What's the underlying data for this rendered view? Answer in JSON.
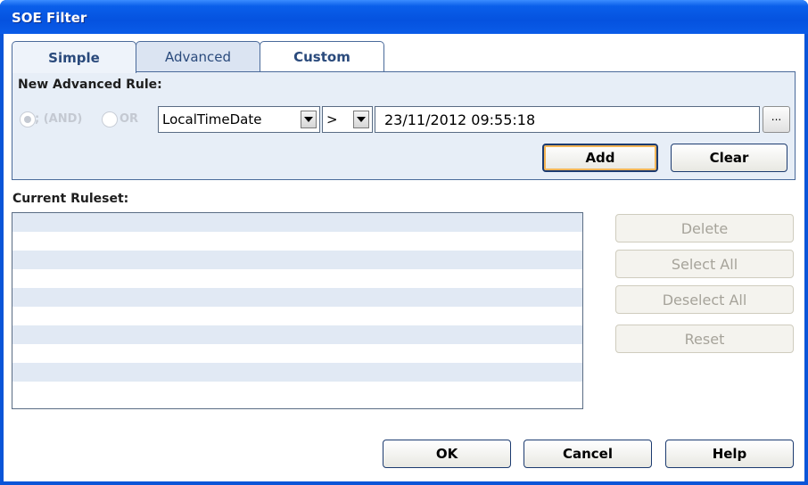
{
  "window": {
    "title": "SOE Filter"
  },
  "tabs": [
    {
      "label": "Simple",
      "state": "active"
    },
    {
      "label": "Advanced",
      "state": "inactive"
    },
    {
      "label": "Custom",
      "state": "plain"
    }
  ],
  "new_rule": {
    "heading": "New Advanced Rule:",
    "radio_and": {
      "label": "; (AND)",
      "checked": true,
      "enabled": false
    },
    "radio_or": {
      "label": "OR",
      "checked": false,
      "enabled": false
    },
    "field_combo": {
      "value": "LocalTimeDate"
    },
    "operator_combo": {
      "value": ">"
    },
    "value_input": {
      "value": "23/11/2012 09:55:18"
    },
    "browse_button": {
      "label": "..."
    },
    "add_button": {
      "label": "Add"
    },
    "clear_button": {
      "label": "Clear"
    }
  },
  "ruleset": {
    "heading": "Current Ruleset:",
    "rows": [
      "",
      "",
      "",
      "",
      "",
      "",
      "",
      "",
      "",
      ""
    ]
  },
  "side_buttons": {
    "delete": "Delete",
    "select_all": "Select All",
    "deselect_all": "Deselect All",
    "reset": "Reset"
  },
  "footer": {
    "ok": "OK",
    "cancel": "Cancel",
    "help": "Help"
  },
  "colors": {
    "title_bar": "#0552df",
    "panel_bg": "#e7eef7",
    "list_alt_row": "#e1e9f4",
    "focus_ring": "#f5b657"
  }
}
